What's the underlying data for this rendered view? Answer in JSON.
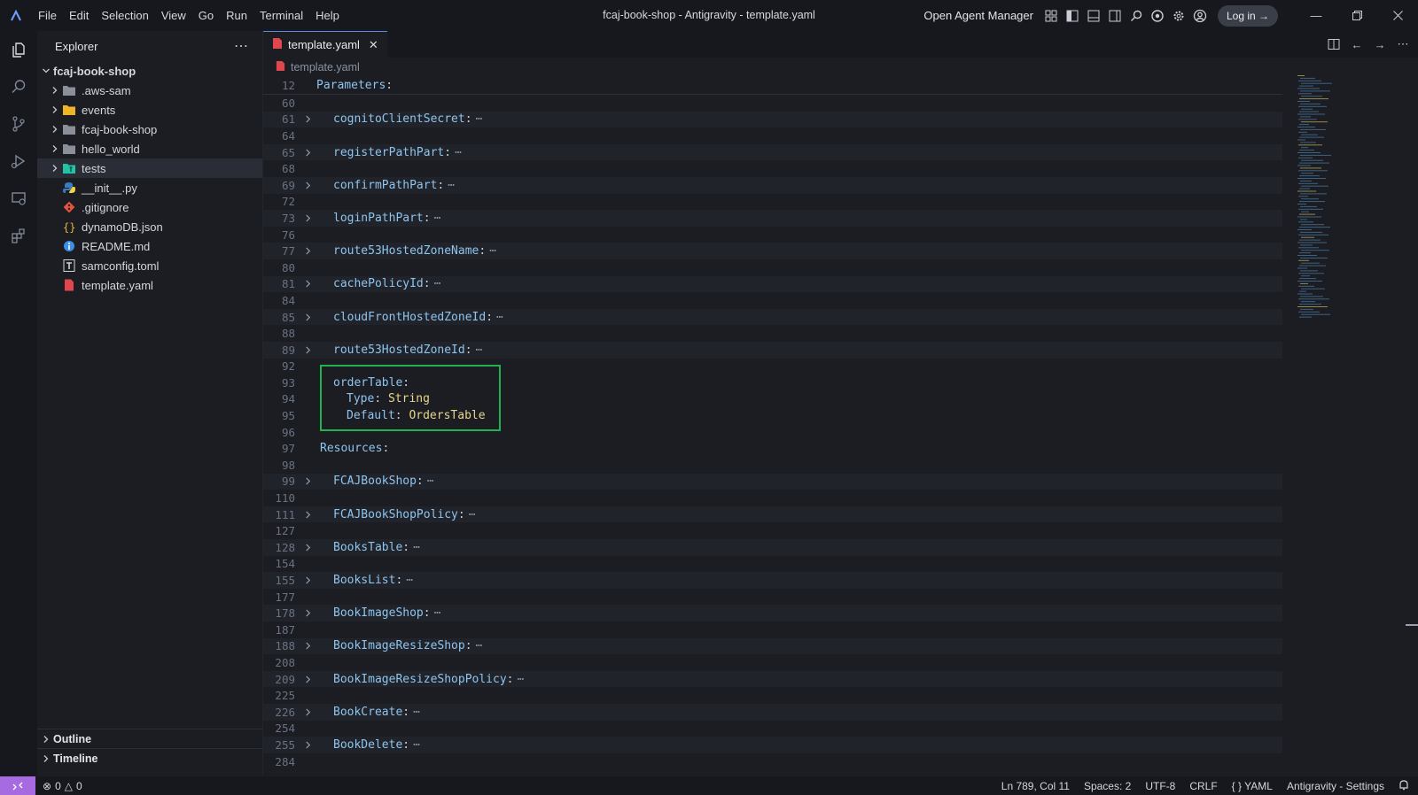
{
  "titlebar": {
    "menu": [
      "File",
      "Edit",
      "Selection",
      "View",
      "Go",
      "Run",
      "Terminal",
      "Help"
    ],
    "window_title": "fcaj-book-shop - Antigravity - template.yaml",
    "agent_manager": "Open Agent Manager",
    "login_label": "Log in →"
  },
  "sidebar": {
    "title": "Explorer",
    "more": "⋯",
    "root": "fcaj-book-shop",
    "items": [
      {
        "label": ".aws-sam",
        "kind": "folder",
        "icon": "folder-icon",
        "color": "#8a8f99"
      },
      {
        "label": "events",
        "kind": "folder",
        "icon": "folder-icon",
        "color": "#f0b429"
      },
      {
        "label": "fcaj-book-shop",
        "kind": "folder",
        "icon": "folder-icon",
        "color": "#8a8f99"
      },
      {
        "label": "hello_world",
        "kind": "folder",
        "icon": "folder-icon",
        "color": "#8a8f99"
      },
      {
        "label": "tests",
        "kind": "folder",
        "icon": "test-folder-icon",
        "color": "#22c3a6"
      },
      {
        "label": "__init__.py",
        "kind": "file",
        "icon": "python-icon"
      },
      {
        "label": ".gitignore",
        "kind": "file",
        "icon": "git-icon"
      },
      {
        "label": "dynamoDB.json",
        "kind": "file",
        "icon": "json-icon"
      },
      {
        "label": "README.md",
        "kind": "file",
        "icon": "info-icon"
      },
      {
        "label": "samconfig.toml",
        "kind": "file",
        "icon": "toml-icon"
      },
      {
        "label": "template.yaml",
        "kind": "file",
        "icon": "yaml-icon"
      }
    ],
    "outline": "Outline",
    "timeline": "Timeline"
  },
  "editor": {
    "tab_label": "template.yaml",
    "breadcrumb": "template.yaml",
    "sticky": {
      "num": "12",
      "key": "Parameters"
    },
    "lines": [
      {
        "num": "60",
        "fold": false,
        "key": "",
        "indent": 0
      },
      {
        "num": "61",
        "fold": true,
        "key": "cognitoClientSecret",
        "indent": 1
      },
      {
        "num": "64",
        "fold": false,
        "key": "",
        "indent": 0
      },
      {
        "num": "65",
        "fold": true,
        "key": "registerPathPart",
        "indent": 1
      },
      {
        "num": "68",
        "fold": false,
        "key": "",
        "indent": 0
      },
      {
        "num": "69",
        "fold": true,
        "key": "confirmPathPart",
        "indent": 1
      },
      {
        "num": "72",
        "fold": false,
        "key": "",
        "indent": 0
      },
      {
        "num": "73",
        "fold": true,
        "key": "loginPathPart",
        "indent": 1
      },
      {
        "num": "76",
        "fold": false,
        "key": "",
        "indent": 0
      },
      {
        "num": "77",
        "fold": true,
        "key": "route53HostedZoneName",
        "indent": 1
      },
      {
        "num": "80",
        "fold": false,
        "key": "",
        "indent": 0
      },
      {
        "num": "81",
        "fold": true,
        "key": "cachePolicyId",
        "indent": 1
      },
      {
        "num": "84",
        "fold": false,
        "key": "",
        "indent": 0
      },
      {
        "num": "85",
        "fold": true,
        "key": "cloudFrontHostedZoneId",
        "indent": 1
      },
      {
        "num": "88",
        "fold": false,
        "key": "",
        "indent": 0
      },
      {
        "num": "89",
        "fold": true,
        "key": "route53HostedZoneId",
        "indent": 1
      },
      {
        "num": "92",
        "fold": false,
        "key": "",
        "indent": 0
      },
      {
        "num": "93",
        "fold": false,
        "key": "orderTable",
        "indent": 1,
        "plain": true
      },
      {
        "num": "94",
        "fold": false,
        "key": "Type",
        "value": "String",
        "indent": 2
      },
      {
        "num": "95",
        "fold": false,
        "key": "Default",
        "value": "OrdersTable",
        "indent": 2
      },
      {
        "num": "96",
        "fold": false,
        "key": "",
        "indent": 0
      },
      {
        "num": "97",
        "fold": false,
        "key": "Resources",
        "indent": 0,
        "plain": true
      },
      {
        "num": "98",
        "fold": false,
        "key": "",
        "indent": 0
      },
      {
        "num": "99",
        "fold": true,
        "key": "FCAJBookShop",
        "indent": 1
      },
      {
        "num": "110",
        "fold": false,
        "key": "",
        "indent": 0
      },
      {
        "num": "111",
        "fold": true,
        "key": "FCAJBookShopPolicy",
        "indent": 1
      },
      {
        "num": "127",
        "fold": false,
        "key": "",
        "indent": 0
      },
      {
        "num": "128",
        "fold": true,
        "key": "BooksTable",
        "indent": 1
      },
      {
        "num": "154",
        "fold": false,
        "key": "",
        "indent": 0
      },
      {
        "num": "155",
        "fold": true,
        "key": "BooksList",
        "indent": 1
      },
      {
        "num": "177",
        "fold": false,
        "key": "",
        "indent": 0
      },
      {
        "num": "178",
        "fold": true,
        "key": "BookImageShop",
        "indent": 1
      },
      {
        "num": "187",
        "fold": false,
        "key": "",
        "indent": 0
      },
      {
        "num": "188",
        "fold": true,
        "key": "BookImageResizeShop",
        "indent": 1
      },
      {
        "num": "208",
        "fold": false,
        "key": "",
        "indent": 0
      },
      {
        "num": "209",
        "fold": true,
        "key": "BookImageResizeShopPolicy",
        "indent": 1
      },
      {
        "num": "225",
        "fold": false,
        "key": "",
        "indent": 0
      },
      {
        "num": "226",
        "fold": true,
        "key": "BookCreate",
        "indent": 1
      },
      {
        "num": "254",
        "fold": false,
        "key": "",
        "indent": 0
      },
      {
        "num": "255",
        "fold": true,
        "key": "BookDelete",
        "indent": 1
      },
      {
        "num": "284",
        "fold": false,
        "key": "",
        "indent": 0
      }
    ]
  },
  "statusbar": {
    "errors": "0",
    "warnings": "0",
    "position": "Ln 789, Col 11",
    "spaces": "Spaces: 2",
    "encoding": "UTF-8",
    "eol": "CRLF",
    "language": "YAML",
    "settings": "Antigravity - Settings"
  },
  "colors": {
    "highlight_box": "#1fb34f",
    "accent": "#5e88e8",
    "remote": "#a66be0"
  }
}
